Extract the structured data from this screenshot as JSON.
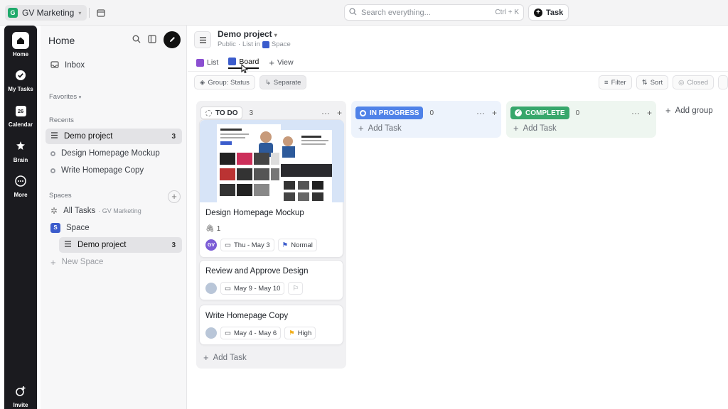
{
  "topbar": {
    "workspace_initial": "G",
    "workspace_name": "GV Marketing",
    "search_placeholder": "Search everything...",
    "search_shortcut": "Ctrl + K",
    "task_button": "Task"
  },
  "rail": {
    "items": [
      {
        "label": "Home",
        "icon": "home-icon"
      },
      {
        "label": "My Tasks",
        "icon": "check-circle-icon"
      },
      {
        "label": "Calendar",
        "icon": "calendar-icon",
        "day": "26"
      },
      {
        "label": "Brain",
        "icon": "brain-icon"
      },
      {
        "label": "More",
        "icon": "more-icon"
      },
      {
        "label": "Invite",
        "icon": "invite-icon"
      }
    ]
  },
  "sidebar": {
    "title": "Home",
    "inbox": "Inbox",
    "favorites_label": "Favorites",
    "favorites_marker": "▾",
    "recents_label": "Recents",
    "recents": [
      {
        "label": "Demo project",
        "count": "3"
      },
      {
        "label": "Design Homepage Mockup"
      },
      {
        "label": "Write Homepage Copy"
      }
    ],
    "spaces_label": "Spaces",
    "all_tasks": "All Tasks",
    "all_tasks_sub": "· GV Marketing",
    "space": "Space",
    "space_initial": "S",
    "demo_project": "Demo project",
    "demo_project_count": "3",
    "new_space": "New Space"
  },
  "header": {
    "project_title": "Demo project",
    "sub_public": "Public",
    "sub_sep": "·",
    "sub_list_in": "List in",
    "sub_space": "Space",
    "views": [
      {
        "label": "List"
      },
      {
        "label": "Board",
        "active": true
      },
      {
        "label": "View"
      }
    ]
  },
  "toolbar": {
    "group": "Group: Status",
    "separate": "Separate",
    "filter": "Filter",
    "sort": "Sort",
    "closed": "Closed"
  },
  "board": {
    "columns": [
      {
        "status": "TO DO",
        "count": "3",
        "color": "#ffffff",
        "text_color": "#2a2e34",
        "bg": "#f1f1f3"
      },
      {
        "status": "IN PROGRESS",
        "count": "0",
        "color": "#4f82e8",
        "text_color": "#ffffff",
        "bg": "#edf3fc"
      },
      {
        "status": "COMPLETE",
        "count": "0",
        "color": "#37a76b",
        "text_color": "#ffffff",
        "bg": "#eef6f0"
      }
    ],
    "add_task": "Add Task",
    "add_group": "Add group",
    "cards": [
      {
        "title": "Design Homepage Mockup",
        "attachments": "1",
        "assignee": "GV",
        "date": "Thu - May 3",
        "priority": "Normal",
        "priority_color": "#3b5ccc"
      },
      {
        "title": "Review and Approve Design",
        "date": "May 9 - May 10",
        "priority": "",
        "priority_color": "#8a8f96"
      },
      {
        "title": "Write Homepage Copy",
        "date": "May 4 - May 6",
        "priority": "High",
        "priority_color": "#f2b01e"
      }
    ]
  }
}
